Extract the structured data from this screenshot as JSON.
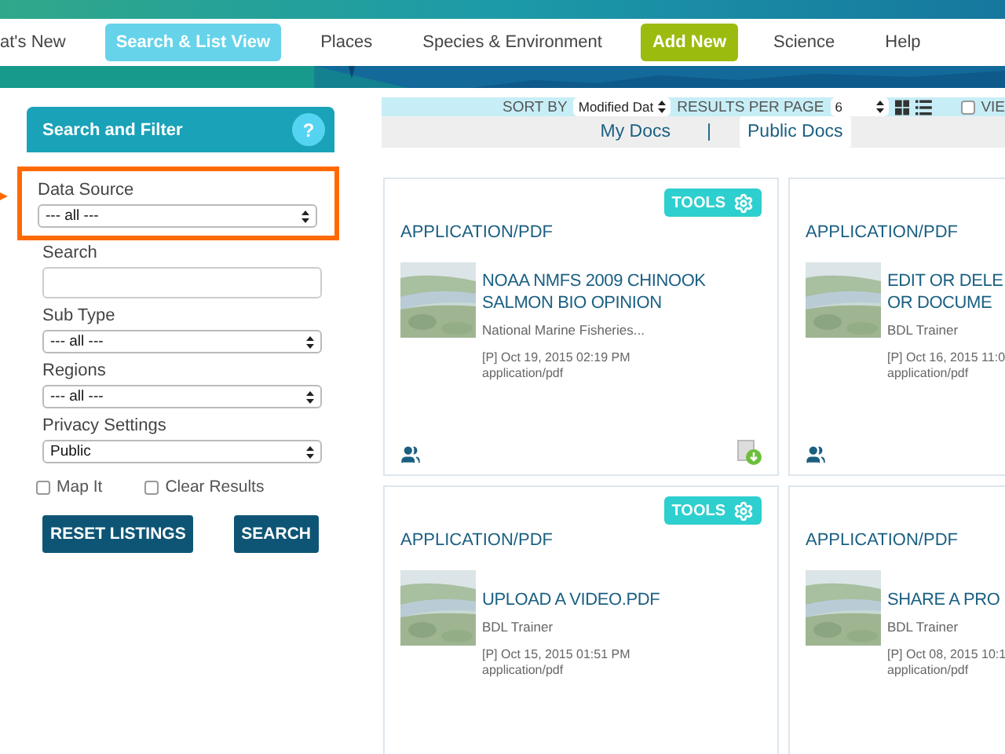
{
  "nav": {
    "items": [
      {
        "label": "at's New",
        "kind": "link",
        "selected": false
      },
      {
        "label": "Search & List View",
        "kind": "link",
        "selected": true
      },
      {
        "label": "Places",
        "kind": "link",
        "selected": false
      },
      {
        "label": "Species & Environment",
        "kind": "link",
        "selected": false
      },
      {
        "label": "Add New",
        "kind": "action",
        "selected": false
      },
      {
        "label": "Science",
        "kind": "link",
        "selected": false
      },
      {
        "label": "Help",
        "kind": "link",
        "selected": false
      }
    ]
  },
  "filter_panel": {
    "title": "Search and Filter",
    "help": "?",
    "fields": [
      {
        "kind": "select",
        "label": "Data Source",
        "value": "--- all ---",
        "highlighted": true
      },
      {
        "kind": "text",
        "label": "Search",
        "highlighted": false
      },
      {
        "kind": "select",
        "label": "Sub Type",
        "value": "--- all ---",
        "highlighted": false
      },
      {
        "kind": "select",
        "label": "Regions",
        "value": "--- all ---",
        "highlighted": false
      },
      {
        "kind": "select",
        "label": "Privacy Settings",
        "value": "Public",
        "highlighted": false
      }
    ],
    "checkboxes": [
      {
        "label": "Map It",
        "checked": false
      },
      {
        "label": "Clear Results",
        "checked": false
      }
    ],
    "buttons": [
      "RESET LISTINGS",
      "SEARCH"
    ]
  },
  "toolbar": {
    "sort_label": "SORT BY",
    "sort_value": "Modified Dat",
    "per_page_label": "RESULTS PER PAGE",
    "per_page_value": "6",
    "view_checkbox": {
      "label": "VIE",
      "checked": false
    }
  },
  "doc_tabs": {
    "separator": "|",
    "items": [
      {
        "label": "My Docs",
        "selected": false
      },
      {
        "label": "Public Docs",
        "selected": true
      }
    ]
  },
  "cards": [
    {
      "tools": "TOOLS",
      "type": "APPLICATION/PDF",
      "title_lines": [
        "NOAA NMFS 2009 CHINOOK",
        "SALMON BIO OPINION"
      ],
      "author": "National Marine Fisheries...",
      "date": "[P] Oct 19, 2015 02:19 PM",
      "mime": "application/pdf",
      "shared": true,
      "downloadable": true
    },
    {
      "type": "APPLICATION/PDF",
      "title_lines": [
        "EDIT OR DELE",
        "OR DOCUME"
      ],
      "author": "BDL Trainer",
      "date": "[P] Oct 16, 2015 11:0",
      "mime": "application/pdf",
      "shared": true
    },
    {
      "tools": "TOOLS",
      "type": "APPLICATION/PDF",
      "title_lines": [
        "UPLOAD A VIDEO.PDF"
      ],
      "author": "BDL Trainer",
      "date": "[P] Oct 15, 2015 01:51 PM",
      "mime": "application/pdf"
    },
    {
      "type": "APPLICATION/PDF",
      "title_lines": [
        "SHARE A PRO"
      ],
      "author": "BDL Trainer",
      "date": "[P] Oct 08, 2015 10:1",
      "mime": "application/pdf"
    }
  ]
}
